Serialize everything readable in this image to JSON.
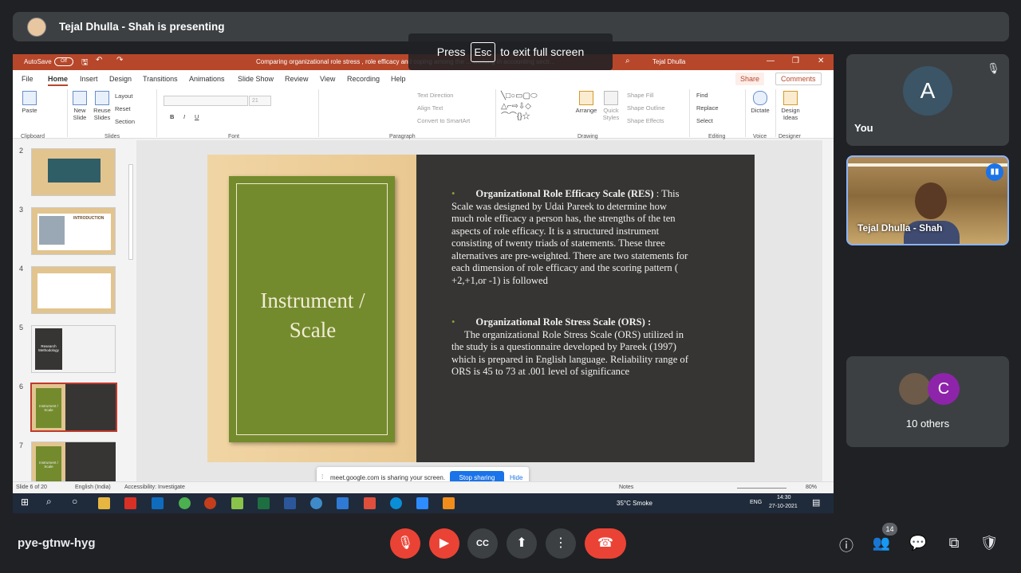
{
  "meet": {
    "presenter_banner": "Tejal Dhulla - Shah is presenting",
    "exit_fullscreen": {
      "prefix": "Press",
      "key": "Esc",
      "suffix": "to exit full screen"
    },
    "meeting_code": "pye-gtnw-hyg",
    "participants_count": "14",
    "tiles": {
      "you_label": "You",
      "you_avatar_letter": "A",
      "presenter_name": "Tejal Dhulla - Shah",
      "others_label": "10 others",
      "others_avatar_letter": "C"
    }
  },
  "powerpoint": {
    "autosave_label": "AutoSave",
    "autosave_state": "Off",
    "doc_title": "Comparing organizational role stress , role efficacy and coping among the ... working in accounting sectr...",
    "user_name": "Tejal Dhulla",
    "menu": [
      "File",
      "Home",
      "Insert",
      "Design",
      "Transitions",
      "Animations",
      "Slide Show",
      "Review",
      "View",
      "Recording",
      "Help"
    ],
    "share_label": "Share",
    "comments_label": "Comments",
    "ribbon": {
      "clipboard": "Clipboard",
      "paste": "Paste",
      "slides": "Slides",
      "new_slide": "New Slide",
      "reuse_slides": "Reuse Slides",
      "layout": "Layout",
      "reset": "Reset",
      "section": "Section",
      "font": "Font",
      "font_size": "21",
      "paragraph": "Paragraph",
      "text_direction": "Text Direction",
      "align_text": "Align Text",
      "convert_smartart": "Convert to SmartArt",
      "drawing": "Drawing",
      "arrange": "Arrange",
      "quick_styles": "Quick Styles",
      "shape_fill": "Shape Fill",
      "shape_outline": "Shape Outline",
      "shape_effects": "Shape Effects",
      "editing": "Editing",
      "find": "Find",
      "replace": "Replace",
      "select": "Select",
      "voice": "Voice",
      "dictate": "Dictate",
      "designer": "Designer",
      "design_ideas": "Design Ideas"
    },
    "thumbnails": [
      "2",
      "3",
      "4",
      "5",
      "6",
      "7"
    ],
    "thumb_titles": {
      "t3": "INTRODUCTION",
      "t5": "Research Methodology",
      "t6": "Instrument / Scale",
      "t7": "Instrument / Scale"
    },
    "slide": {
      "title": "Instrument / Scale",
      "bullet1_head": "Organizational Role Efficacy Scale (RES)",
      "bullet1_body": ": This Scale was designed by Udai Pareek to determine how much role efficacy a person has, the strengths of the ten aspects of role efficacy. It is a structured instrument consisting of twenty triads of statements. These three alternatives are pre-weighted. There are two statements for each dimension of role efficacy and the scoring pattern ( +2,+1,or -1) is followed",
      "bullet2_head": "Organizational Role Stress Scale (ORS) :",
      "bullet2_body": "The organizational Role Stress Scale (ORS) utilized in the study is a questionnaire developed by Pareek (1997) which is prepared in English language. Reliability range of ORS is 45 to 73 at .001 level of significance"
    },
    "sharing_bar": {
      "text": "meet.google.com is sharing your screen.",
      "stop": "Stop sharing",
      "hide": "Hide"
    },
    "status": {
      "slide_info": "Slide 6 of 20",
      "language": "English (India)",
      "accessibility": "Accessibility: Investigate",
      "notes": "Notes",
      "zoom": "80%"
    },
    "taskbar": {
      "weather": "35°C  Smoke",
      "lang": "ENG",
      "time": "14:30",
      "date": "27-10-2021"
    }
  },
  "colors": {
    "accent_red": "#ea4335",
    "ppt_orange": "#b7472a",
    "slide_green": "#738b2d",
    "meet_blue": "#1a73e8"
  }
}
